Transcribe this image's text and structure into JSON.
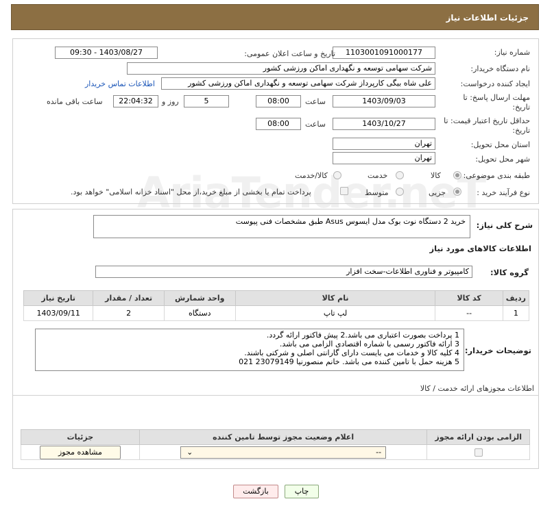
{
  "header": {
    "title": "جزئیات اطلاعات نیاز"
  },
  "form": {
    "need_number_label": "شماره نیاز:",
    "need_number": "1103001091000177",
    "announce_label": "تاریخ و ساعت اعلان عمومی:",
    "announce_value": "1403/08/27 - 09:30",
    "buyer_label": "نام دستگاه خریدار:",
    "buyer_value": "شرکت سهامی توسعه و نگهداری اماکن ورزشی کشور",
    "creator_label": "ایجاد کننده درخواست:",
    "creator_value": "علی شاه بیگی کارپرداز شرکت سهامی توسعه و نگهداری اماکن ورزشی کشور",
    "contact_link": "اطلاعات تماس خریدار",
    "deadline_label_1": "مهلت ارسال پاسخ: تا",
    "deadline_label_2": "تاریخ:",
    "deadline_date": "1403/09/03",
    "time_label": "ساعت",
    "deadline_time": "08:00",
    "days_value": "5",
    "days_label": "روز و",
    "remaining_time": "22:04:32",
    "remaining_label": "ساعت باقی مانده",
    "validity_label_1": "حداقل تاریخ اعتبار قیمت: تا",
    "validity_label_2": "تاریخ:",
    "validity_date": "1403/10/27",
    "validity_time": "08:00",
    "province_label": "استان محل تحویل:",
    "province_value": "تهران",
    "city_label": "شهر محل تحویل:",
    "city_value": "تهران",
    "category_label": "طبقه بندی موضوعی:",
    "category_options": [
      "کالا",
      "خدمت",
      "کالا/خدمت"
    ],
    "process_label": "نوع فرآیند خرید :",
    "process_options": [
      "جزیی",
      "متوسط"
    ],
    "payment_note": "پرداخت تمام یا بخشی از مبلغ خرید،از محل \"اسناد خزانه اسلامی\" خواهد بود."
  },
  "description": {
    "label": "شرح کلی نیاز:",
    "value": "خرید 2 دستگاه نوت بوک مدل ایسوس Asus طبق مشخصات فنی پیوست"
  },
  "goods": {
    "section_title": "اطلاعات کالاهای مورد نیاز",
    "group_label": "گروه کالا:",
    "group_value": "کامپیوتر و فناوری اطلاعات-سخت افزار",
    "columns": [
      "ردیف",
      "کد کالا",
      "نام کالا",
      "واحد شمارش",
      "تعداد / مقدار",
      "تاریخ نیاز"
    ],
    "rows": [
      {
        "row": "1",
        "code": "--",
        "name": "لپ تاپ",
        "unit": "دستگاه",
        "qty": "2",
        "date": "1403/09/11"
      }
    ]
  },
  "buyer_notes": {
    "label": "توضیحات خریدار:",
    "lines": [
      "1 پرداخت بصورت اعتباری می باشد.2 پیش فاکتور ارائه گردد.",
      "3 ارائه فاکتور رسمی با شماره اقتصادی الزامی می باشد.",
      "4 کلیه کالا و خدمات می بایست دارای گارانتی اصلی و شرکتی باشند.",
      "5 هزینه حمل با تامین کننده می باشد. خانم منصورنیا  23079149   021"
    ]
  },
  "permits": {
    "section_title": "اطلاعات مجوزهای ارائه خدمت / کالا",
    "columns": [
      "الزامی بودن ارائه مجوز",
      "اعلام وضعیت مجوز توسط تامین کننده",
      "جزئیات"
    ],
    "select_value": "--",
    "view_button": "مشاهده مجوز"
  },
  "actions": {
    "print": "چاپ",
    "back": "بازگشت"
  },
  "watermark": "AriaTender.neT"
}
